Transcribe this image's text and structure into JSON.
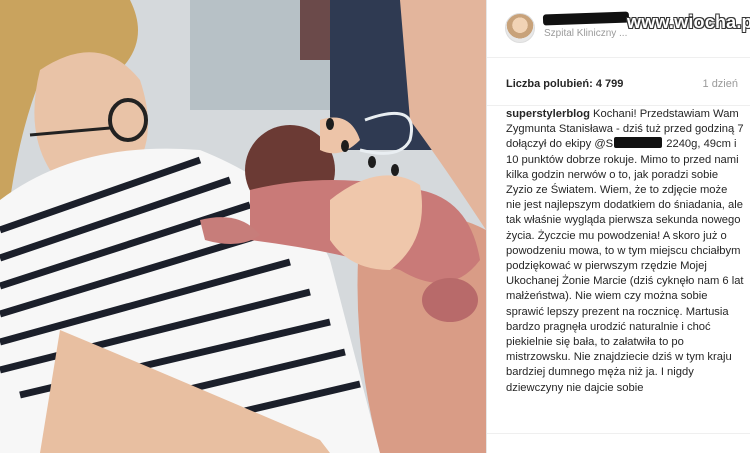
{
  "post": {
    "location": "Szpital Kliniczny ...",
    "watermark": "www.wiocha.pl",
    "likes_label": "Liczba polubień: 4 799",
    "time_ago": "1 dzień",
    "author": "superstylerblog",
    "caption_part1": " Kochani! Przedstawiam Wam Zygmunta Stanisława - dziś tuż przed godziną 7 dołączył do ekipy ",
    "caption_handle_prefix": "@S",
    "caption_part2": " 2240g, 49cm i 10 punktów dobrze rokuje. Mimo to przed nami kilka godzin nerwów o to, jak poradzi sobie Zyzio ze Światem. Wiem, że to zdjęcie może nie jest najlepszym dodatkiem do śniadania, ale tak właśnie wygląda pierwsza sekunda nowego życia. Życzcie mu powodzenia! A skoro już o powodzeniu mowa, to w tym miejscu chciałbym podziękować w pierwszym rzędzie Mojej Ukochanej Żonie Marcie (dziś cyknęło nam 6 lat małżeństwa). Nie wiem czy można sobie sprawić lepszy prezent na rocznicę. Martusia bardzo pragnęła urodzić naturalnie i choć piekielnie się bała, to załatwiła to po mistrzowsku. Nie znajdziecie dziś w tym kraju bardziej dumnego męża niż ja. I nigdy dziewczyny nie dajcie sobie"
  },
  "colors": {
    "text": "#262626",
    "muted": "#9a9a9a",
    "divider": "#efefef"
  }
}
